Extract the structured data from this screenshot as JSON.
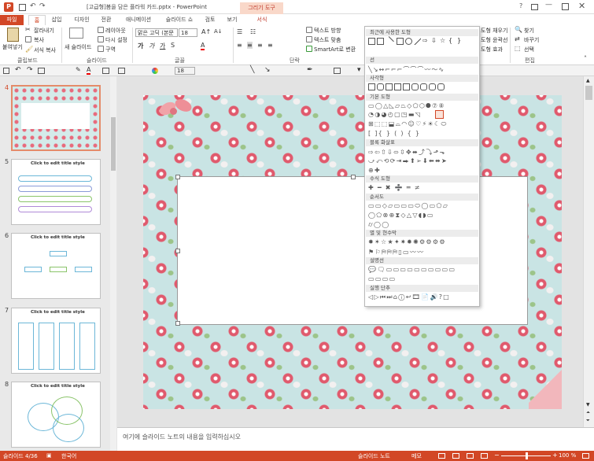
{
  "window": {
    "title": "[고급형]봄을 담은 플라워 카드.pptx - PowerPoint",
    "context_tab_group": "그리기 도구",
    "help": "?"
  },
  "tabs": [
    "파일",
    "홈",
    "삽입",
    "디자인",
    "전환",
    "애니메이션",
    "슬라이드 쇼",
    "검토",
    "보기",
    "서식"
  ],
  "ribbon": {
    "clipboard": {
      "paste": "붙여넣기",
      "cut": "잘라내기",
      "copy": "복사",
      "format_painter": "서식 복사",
      "label": "클립보드"
    },
    "slides": {
      "new_slide": "새 슬라이드",
      "layout": "레이아웃",
      "reset": "다시 설정",
      "section": "구역",
      "label": "슬라이드"
    },
    "font": {
      "font_name": "맑은 고딕 (본문",
      "font_size": "18",
      "label": "글꼴"
    },
    "paragraph": {
      "text_direction": "텍스트 방향",
      "align_text": "텍스트 맞춤",
      "smartart": "SmartArt로 변환",
      "label": "단락"
    },
    "drawing": {
      "shape_fill": "도형 채우기",
      "shape_outline": "도형 윤곽선",
      "shape_effects": "도형 효과"
    },
    "editing": {
      "find": "찾기",
      "replace": "바꾸기",
      "select": "선택",
      "label": "편집"
    }
  },
  "qat": {
    "font_size": "18"
  },
  "shape_gallery": {
    "categories": [
      "최근에 사용한 도형",
      "선",
      "사각형",
      "기본 도형",
      "블록 화살표",
      "수식 도형",
      "순서도",
      "별 및 현수막",
      "설명선",
      "실행 단추"
    ]
  },
  "slides": [
    {
      "number": "4"
    },
    {
      "number": "5",
      "title": "Click to edit title style"
    },
    {
      "number": "6",
      "title": "Click to edit title style"
    },
    {
      "number": "7",
      "title": "Click to edit title style"
    },
    {
      "number": "8",
      "title": "Click to edit title style"
    }
  ],
  "notes": {
    "placeholder": "여기에 슬라이드 노트의 내용을 입력하십시오"
  },
  "status": {
    "slide_info": "슬라이드 4/36",
    "language": "한국어",
    "notes": "슬라이드 노트",
    "comments": "메모",
    "zoom": "100 %"
  },
  "colors": {
    "accent": "#d24726",
    "slide_bg": "#c9e4e4",
    "rose": "#e05a6d"
  }
}
